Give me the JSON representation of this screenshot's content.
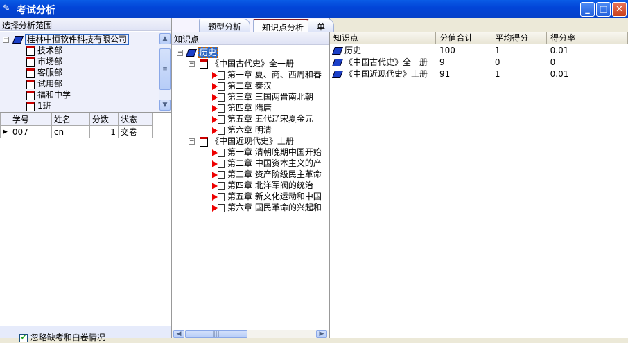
{
  "window": {
    "title": "考试分析",
    "minimize": "_",
    "maximize": "□",
    "close": "✕"
  },
  "scope": {
    "header": "选择分析范围",
    "root": "桂林中恒软件科技有限公司",
    "children": [
      "技术部",
      "市场部",
      "客服部",
      "试用部",
      "福和中学",
      "1班"
    ]
  },
  "grid": {
    "columns": [
      "学号",
      "姓名",
      "分数",
      "状态"
    ],
    "rows": [
      {
        "id": "007",
        "name": "cn",
        "score": "1",
        "status": "交卷"
      }
    ]
  },
  "ignore_absent": {
    "label": "忽略缺考和白卷情况",
    "checked": true
  },
  "tabs": [
    "题型分析",
    "知识点分析",
    "单题分析"
  ],
  "active_tab": 1,
  "knowledge": {
    "header": "知识点",
    "root": "历史",
    "books": [
      {
        "title": "《中国古代史》全一册",
        "chapters": [
          "第一章  夏、商、西周和春",
          "第二章  秦汉",
          "第三章  三国两晋南北朝",
          "第四章  隋唐",
          "第五章  五代辽宋夏金元",
          "第六章  明清"
        ]
      },
      {
        "title": "《中国近现代史》上册",
        "chapters": [
          "第一章  清朝晚期中国开始",
          "第二章  中国资本主义的产",
          "第三章  资产阶级民主革命",
          "第四章  北洋军阀的统治",
          "第五章  新文化运动和中国",
          "第六章  国民革命的兴起和"
        ]
      }
    ]
  },
  "results": {
    "columns": [
      "知识点",
      "分值合计",
      "平均得分",
      "得分率"
    ],
    "rows": [
      {
        "name": "历史",
        "total": "100",
        "avg": "1",
        "rate": "0.01"
      },
      {
        "name": "《中国古代史》全一册",
        "total": "9",
        "avg": "0",
        "rate": "0"
      },
      {
        "name": "《中国近现代史》上册",
        "total": "91",
        "avg": "1",
        "rate": "0.01"
      }
    ]
  }
}
